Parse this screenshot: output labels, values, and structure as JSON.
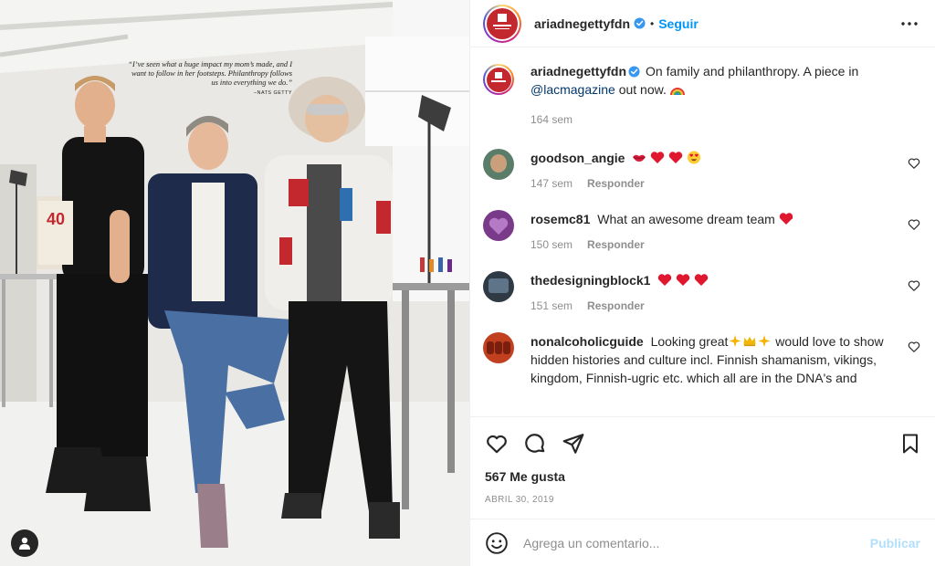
{
  "post": {
    "username": "ariadnegettyfdn",
    "follow_label": "Seguir",
    "dot": "•",
    "caption": {
      "username": "ariadnegettyfdn",
      "text_1": "On family and philanthropy. A piece in",
      "mention": "@lacmagazine",
      "text_2": "out now.",
      "emoji_icon": "rainbow-emoji",
      "age": "164 sem"
    },
    "likes": "567 Me gusta",
    "date": "ABRIL 30, 2019",
    "comment_placeholder": "Agrega un comentario...",
    "publish_label": "Publicar"
  },
  "photo": {
    "quote_text": "“I’ve seen what a huge impact my mom’s made, and I want to follow in her footsteps. Philanthropy follows us into everything we do.”",
    "quote_attr": "–NATS GETTY"
  },
  "comments": [
    {
      "username": "goodson_angie",
      "text": "",
      "emojis": [
        "kiss-lips-emoji",
        "red-heart-emoji",
        "red-heart-emoji",
        "heart-eyes-emoji"
      ],
      "age": "147 sem",
      "reply_label": "Responder",
      "avatar_color": "#5a7d6a"
    },
    {
      "username": "rosemc81",
      "text": "What an awesome dream team",
      "emojis": [
        "growing-heart-emoji"
      ],
      "age": "150 sem",
      "reply_label": "Responder",
      "avatar_color": "#7a3a8a"
    },
    {
      "username": "thedesigningblock1",
      "text": "",
      "emojis": [
        "red-heart-emoji",
        "red-heart-emoji",
        "red-heart-emoji"
      ],
      "age": "151 sem",
      "reply_label": "Responder",
      "avatar_color": "#2f3a45"
    },
    {
      "username": "nonalcoholicguide",
      "text_1": "Looking great",
      "emojis_1": [
        "sparkles-emoji",
        "crown-emoji",
        "sparkles-emoji"
      ],
      "text_2": "would love to show hidden histories and culture incl. Finnish shamanism, vikings, kingdom, Finnish-ugric etc. which all are in the DNA's and",
      "avatar_color": "#c0401f"
    }
  ],
  "colors": {
    "accent": "#0095f6",
    "brand_red": "#c4282f",
    "muted": "#8e8e8e",
    "text": "#262626"
  }
}
